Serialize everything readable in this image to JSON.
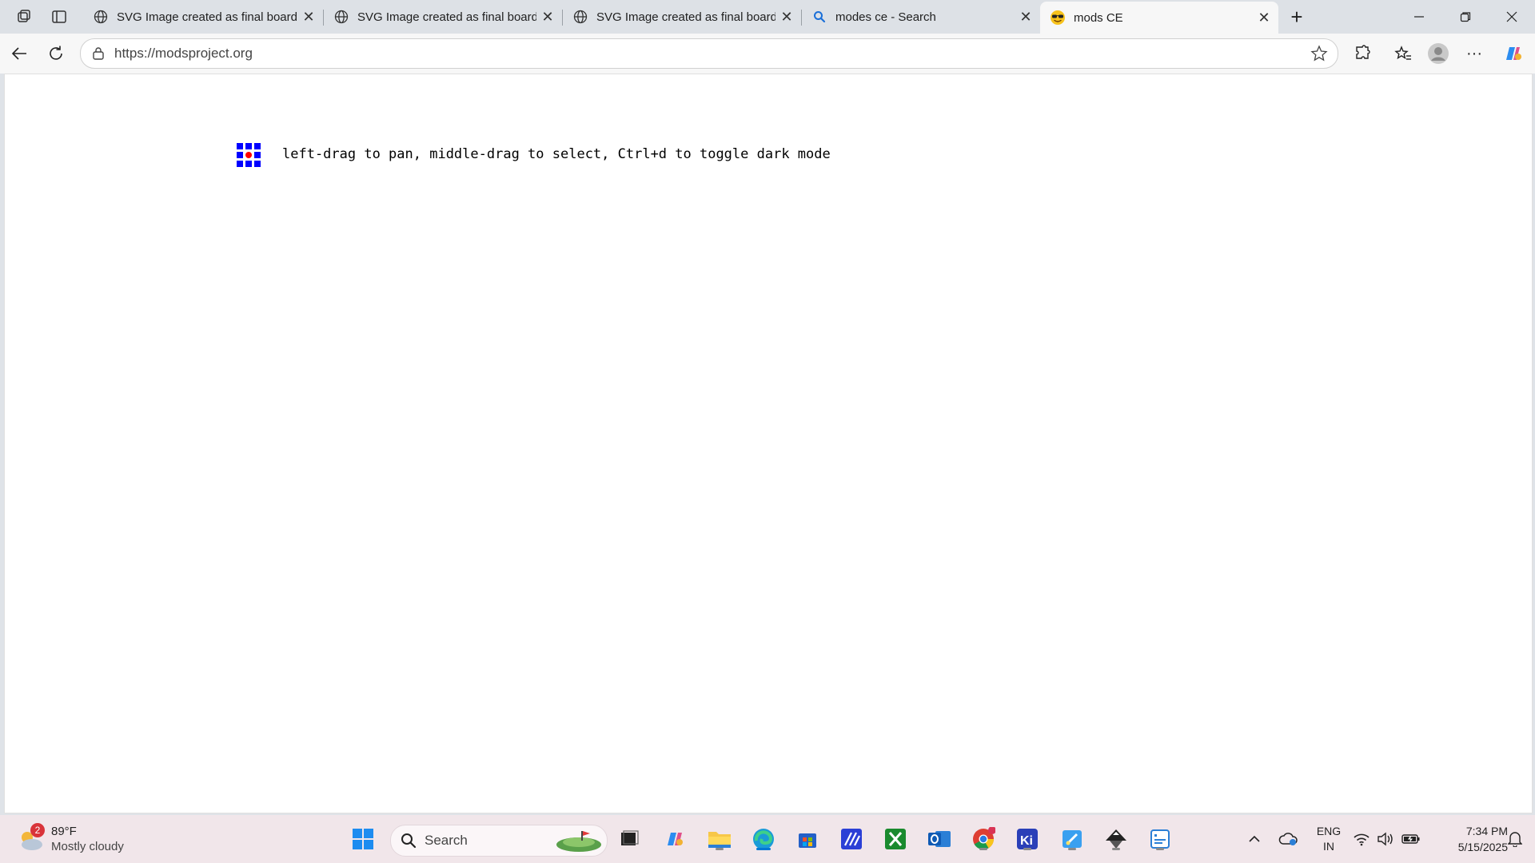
{
  "tabs": [
    {
      "title": "SVG Image created as final board"
    },
    {
      "title": "SVG Image created as final board"
    },
    {
      "title": "SVG Image created as final board"
    },
    {
      "title": "modes ce - Search"
    },
    {
      "title": "mods CE"
    }
  ],
  "address": {
    "url": "https://modsproject.org"
  },
  "page": {
    "hint": "left-drag to pan, middle-drag to select, Ctrl+d to toggle dark mode"
  },
  "taskbar": {
    "weather": {
      "badge": "2",
      "temp": "89°F",
      "condition": "Mostly cloudy"
    },
    "search_placeholder": "Search",
    "lang": {
      "line1": "ENG",
      "line2": "IN"
    },
    "clock": {
      "time": "7:34 PM",
      "date": "5/15/2025"
    }
  },
  "colors": {
    "accent": "#0078d4",
    "logo_blue": "#0000ff",
    "logo_red": "#ff0000"
  }
}
